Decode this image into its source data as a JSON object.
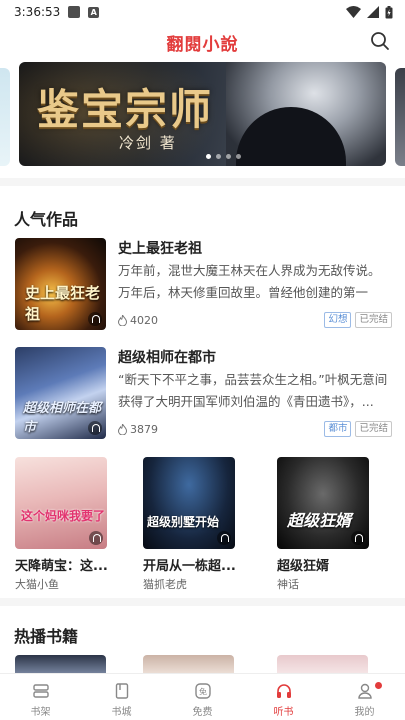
{
  "status_bar": {
    "time": "3:36:53",
    "icon_a": "A"
  },
  "app": {
    "title": "翻閱小說",
    "brand_color": "#e23c3c"
  },
  "banner": {
    "title": "鉴宝宗师",
    "author": "冷剑 著",
    "slides": 4,
    "active_slide": 1
  },
  "popular": {
    "title": "人气作品",
    "books": [
      {
        "name": "史上最狂老祖",
        "desc": "万年前，混世大魔王林天在人界成为无敌传说。万年后，林天修重回故里。曾经他创建的第一大...",
        "count": "4020",
        "tags": [
          "幻想",
          "已完结"
        ],
        "cover_text": "史上最狂老祖"
      },
      {
        "name": "超级相师在都市",
        "desc": "“断天下不平之事，品芸芸众生之相。”叶枫无意间获得了大明开国军师刘伯温的《青田遗书》，...",
        "count": "3879",
        "tags": [
          "都市",
          "已完结"
        ],
        "cover_text": "超级相师在都市"
      }
    ],
    "grid": [
      {
        "name": "天降萌宝：这...",
        "author": "大猫小鱼",
        "cover_text": "这个妈咪我要了"
      },
      {
        "name": "开局从一栋超...",
        "author": "猫抓老虎",
        "cover_text": "超级别墅开始"
      },
      {
        "name": "超级狂婿",
        "author": "神话",
        "cover_text": "超级狂婿"
      }
    ]
  },
  "hot": {
    "title": "热播书籍"
  },
  "tabbar": {
    "items": [
      {
        "label": "书架",
        "icon": "bookshelf-icon"
      },
      {
        "label": "书城",
        "icon": "bookstore-icon"
      },
      {
        "label": "免费",
        "icon": "free-icon"
      },
      {
        "label": "听书",
        "icon": "headphones-icon",
        "active": true
      },
      {
        "label": "我的",
        "icon": "profile-icon",
        "badge": true
      }
    ]
  }
}
